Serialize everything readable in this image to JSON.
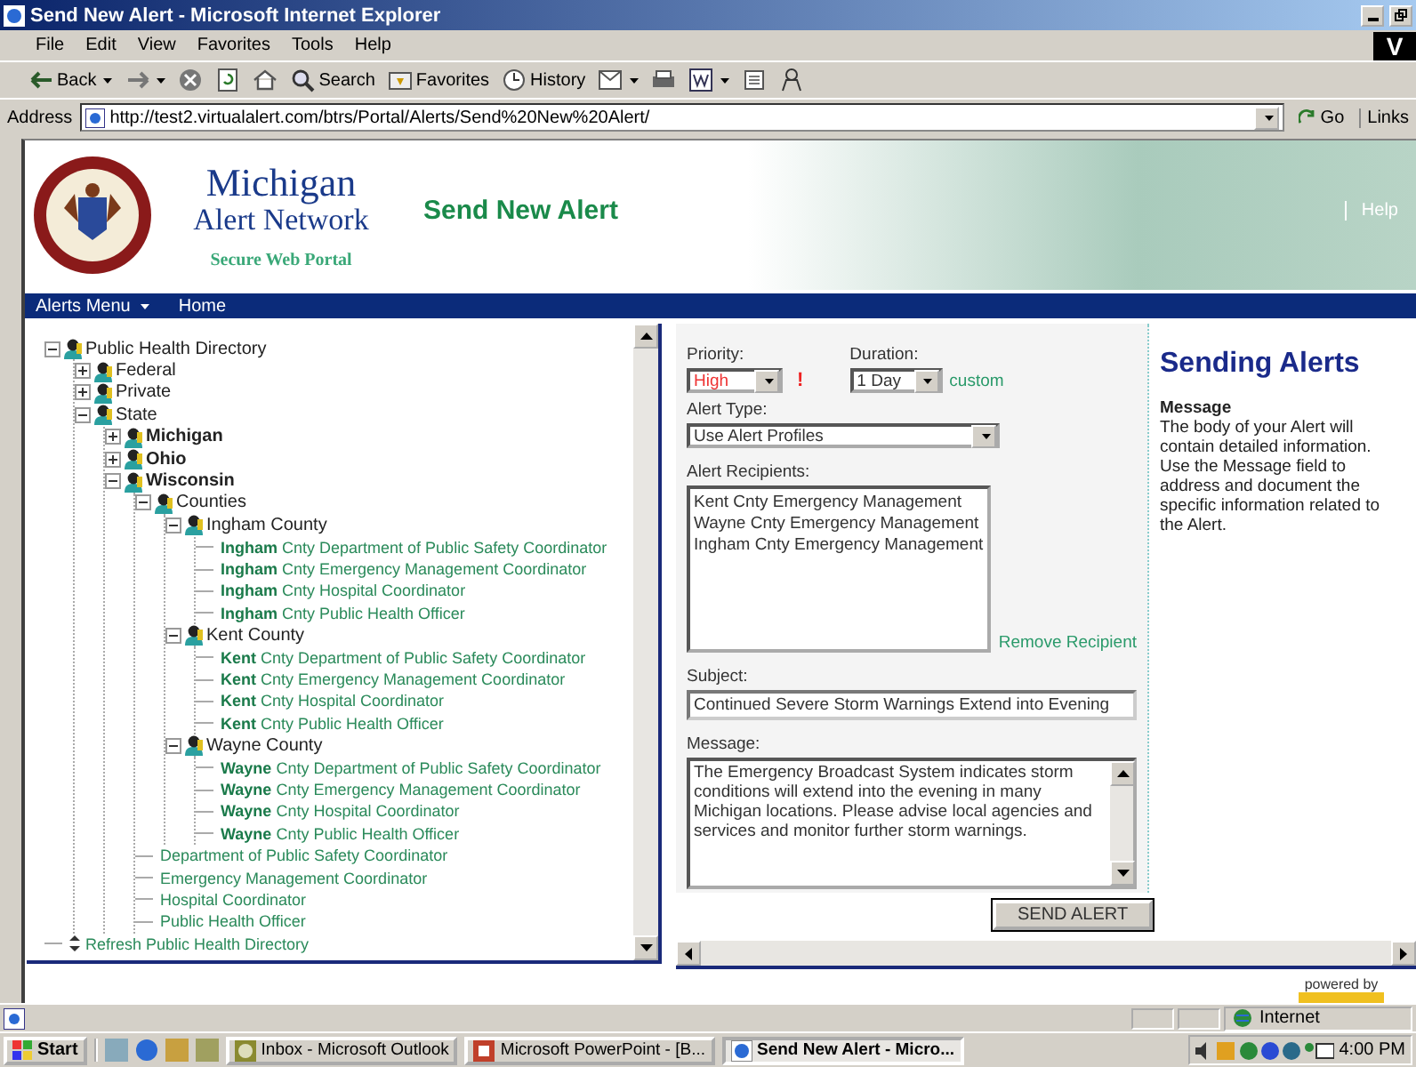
{
  "window": {
    "title": "Send New Alert - Microsoft Internet Explorer"
  },
  "menu_bar": [
    "File",
    "Edit",
    "View",
    "Favorites",
    "Tools",
    "Help"
  ],
  "throbber": "V",
  "toolbar": [
    {
      "kind": "back",
      "label": "Back",
      "dropdown": true
    },
    {
      "kind": "forward",
      "dropdown": true
    },
    {
      "kind": "stop",
      "dropdown": false
    },
    {
      "kind": "refresh",
      "dropdown": false
    },
    {
      "kind": "home",
      "dropdown": false
    },
    {
      "kind": "search",
      "label": "Search",
      "dropdown": false
    },
    {
      "kind": "favorites",
      "label": "Favorites",
      "dropdown": false
    },
    {
      "kind": "history",
      "label": "History",
      "dropdown": false
    },
    {
      "kind": "mail",
      "dropdown": true
    },
    {
      "kind": "print",
      "dropdown": false
    },
    {
      "kind": "edit",
      "dropdown": true
    },
    {
      "kind": "page",
      "dropdown": false
    },
    {
      "kind": "people",
      "dropdown": false
    }
  ],
  "address_bar": {
    "label": "Address",
    "url": "http://test2.virtualalert.com/btrs/Portal/Alerts/Send%20New%20Alert/",
    "go": "Go",
    "links": "Links"
  },
  "header": {
    "title_line1": "Michigan",
    "title_line2": "Alert Network",
    "tagline": "Secure Web Portal",
    "page_title": "Send New Alert",
    "help_link": "Help"
  },
  "nav": [
    {
      "label": "Alerts Menu",
      "dropdown": true
    },
    {
      "label": "Home",
      "dropdown": false
    }
  ],
  "tree": [
    {
      "kind": "group",
      "label": "Public Health Directory",
      "expanded": true,
      "bold": false,
      "children": [
        {
          "kind": "group",
          "label": "Federal",
          "expanded": false,
          "bold": false
        },
        {
          "kind": "group",
          "label": "Private",
          "expanded": false,
          "bold": false
        },
        {
          "kind": "group",
          "label": "State",
          "expanded": true,
          "bold": false,
          "children": [
            {
              "kind": "group",
              "label": "Michigan",
              "expanded": false,
              "bold": true
            },
            {
              "kind": "group",
              "label": "Ohio",
              "expanded": false,
              "bold": true
            },
            {
              "kind": "group",
              "label": "Wisconsin",
              "expanded": true,
              "bold": true,
              "children": [
                {
                  "kind": "group",
                  "label": "Counties",
                  "expanded": true,
                  "bold": false,
                  "children": [
                    {
                      "kind": "group",
                      "label": "Ingham County",
                      "expanded": true,
                      "bold": false,
                      "children": [
                        {
                          "kind": "contact",
                          "label": "**Ingham** Cnty Department of Public Safety Coordinator"
                        },
                        {
                          "kind": "contact",
                          "label": "**Ingham** Cnty Emergency Management Coordinator"
                        },
                        {
                          "kind": "contact",
                          "label": "**Ingham** Cnty Hospital Coordinator"
                        },
                        {
                          "kind": "contact",
                          "label": "**Ingham** Cnty Public Health Officer"
                        }
                      ]
                    },
                    {
                      "kind": "group",
                      "label": "Kent County",
                      "expanded": true,
                      "bold": false,
                      "children": [
                        {
                          "kind": "contact",
                          "label": "**Kent** Cnty Department of Public Safety Coordinator"
                        },
                        {
                          "kind": "contact",
                          "label": "**Kent** Cnty Emergency Management Coordinator"
                        },
                        {
                          "kind": "contact",
                          "label": "**Kent** Cnty Hospital Coordinator"
                        },
                        {
                          "kind": "contact",
                          "label": "**Kent** Cnty Public Health Officer"
                        }
                      ]
                    },
                    {
                      "kind": "group",
                      "label": "Wayne County",
                      "expanded": true,
                      "bold": false,
                      "children": [
                        {
                          "kind": "contact",
                          "label": "**Wayne** Cnty Department of Public Safety Coordinator"
                        },
                        {
                          "kind": "contact",
                          "label": "**Wayne** Cnty Emergency Management Coordinator"
                        },
                        {
                          "kind": "contact",
                          "label": "**Wayne** Cnty Hospital Coordinator"
                        },
                        {
                          "kind": "contact",
                          "label": "**Wayne** Cnty Public Health Officer"
                        }
                      ]
                    }
                  ]
                },
                {
                  "kind": "contact",
                  "label": "Department of Public Safety Coordinator"
                },
                {
                  "kind": "contact",
                  "label": "Emergency Management Coordinator"
                },
                {
                  "kind": "contact",
                  "label": "Hospital Coordinator"
                },
                {
                  "kind": "contact",
                  "label": "Public Health Officer"
                }
              ]
            }
          ]
        }
      ]
    },
    {
      "kind": "refresh",
      "label": "Refresh Public Health Directory"
    }
  ],
  "form": {
    "priority": {
      "label": "Priority:",
      "value": "High",
      "flag": "!"
    },
    "duration": {
      "label": "Duration:",
      "value": "1 Day",
      "link": "custom"
    },
    "alert_type": {
      "label": "Alert Type:",
      "value": "Use Alert Profiles"
    },
    "recipients": {
      "label": "Alert Recipients:",
      "items": [
        "Kent Cnty Emergency Management",
        "Wayne Cnty Emergency Management",
        "Ingham Cnty Emergency Management"
      ],
      "remove": "Remove Recipient"
    },
    "subject": {
      "label": "Subject:",
      "value": "Continued Severe Storm Warnings Extend into Evening"
    },
    "message": {
      "label": "Message:",
      "value": "The Emergency Broadcast System indicates storm conditions will extend into the evening in many Michigan locations.  Please advise local agencies and services and monitor further storm warnings."
    },
    "send": "SEND ALERT"
  },
  "help": {
    "title": "Sending Alerts",
    "heading": "Message",
    "body": "The body of your Alert will contain detailed information. Use the Message field to address and document the specific information related to the Alert."
  },
  "footer": {
    "powered_by": "powered by"
  },
  "status_bar": {
    "zone": "Internet"
  },
  "taskbar": {
    "start": "Start",
    "tasks": [
      {
        "label": "Inbox - Microsoft Outlook",
        "kind": "outlook",
        "selected": false
      },
      {
        "label": "Microsoft PowerPoint - [B...",
        "kind": "powerpoint",
        "selected": false
      },
      {
        "label": "Send New Alert - Micro...",
        "kind": "browser",
        "selected": true
      }
    ],
    "clock": "4:00 PM"
  }
}
